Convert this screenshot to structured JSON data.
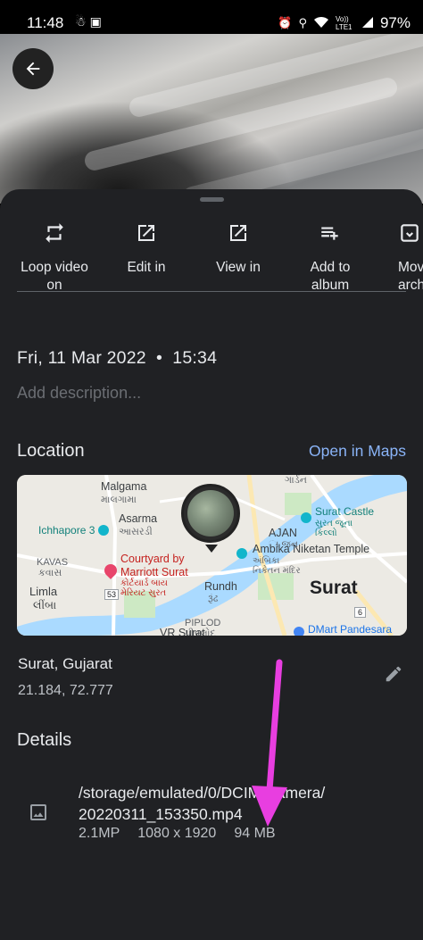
{
  "status_bar": {
    "time": "11:48",
    "battery": "97%",
    "left_icons": [
      "notification-icon",
      "screenshot-icon"
    ],
    "right_icons": [
      "alarm-icon",
      "location-icon",
      "wifi-icon",
      "volte-icon",
      "signal-icon"
    ],
    "volte_label": "Vo)) LTE1"
  },
  "header": {
    "back_icon": "arrow-back-icon"
  },
  "actions": [
    {
      "label": "Loop video\non",
      "icon": "loop-icon"
    },
    {
      "label": "Edit in",
      "icon": "open-external-icon"
    },
    {
      "label": "View in",
      "icon": "open-external-icon"
    },
    {
      "label": "Add to\nalbum",
      "icon": "playlist-add-icon"
    },
    {
      "label": "Mov\narch",
      "icon": "archive-icon"
    }
  ],
  "info": {
    "datetime": "Fri, 11 Mar 2022  •  15:34",
    "description_placeholder": "Add description..."
  },
  "location": {
    "title": "Location",
    "open_maps": "Open in Maps",
    "map_labels": {
      "malgama": "Malgama",
      "malgama_gu": "માલગામા",
      "asarma": "Asarma",
      "asarma_gu": "આસરડી",
      "ichhapore": "Ichhapore 3",
      "kavas": "KAVAS",
      "kavas_gu": "કવાસ",
      "limla": "Limla",
      "limla_gu": "લીંબા",
      "courtyard": "Courtyard by",
      "marriott": "Marriott Surat",
      "marriott_gu": "કોર્ટયાર્ડ બાય\nમેરિયટ સુરત",
      "road_53": "53",
      "rundh": "Rundh",
      "rundh_gu": "રૂંઢ",
      "piplod": "PIPLOD",
      "piplod_gu": "પીપલોદ",
      "rajan": "AJAN",
      "rajan_gu": "ા જન",
      "surat_castle": "Surat Castle",
      "surat_castle_gu": "સુરત જૂના\nકિલ્લો",
      "ambika": "Ambika Niketan Temple",
      "ambika_gu": "અંબિકા\nનિકેતન મંદિર",
      "surat": "Surat",
      "road_6": "6",
      "dmart": "DMart Pandesara",
      "garden": "ગાર્ડન",
      "vr_surat": "VR Surat"
    },
    "place_name": "Surat, Gujarat",
    "coordinates": "21.184, 72.777",
    "edit_icon": "edit-pencil-icon"
  },
  "details": {
    "title": "Details",
    "file_icon": "image-icon",
    "file_path": "/storage/emulated/0/DCIM/Camera/\n20220311_153350.mp4",
    "megapixels": "2.1MP",
    "resolution": "1080 x 1920",
    "size": "94 MB"
  },
  "annotation": {
    "color": "#e83ee0",
    "icon": "arrow-down-annotation"
  }
}
